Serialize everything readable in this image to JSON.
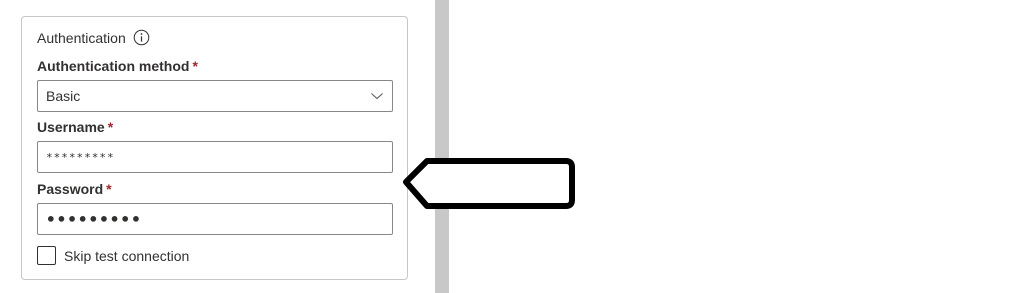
{
  "authentication": {
    "section_title": "Authentication",
    "info_icon": "info-icon",
    "method": {
      "label": "Authentication method",
      "required_marker": "*",
      "value": "Basic"
    },
    "username": {
      "label": "Username",
      "required_marker": "*",
      "value": "*********"
    },
    "password": {
      "label": "Password",
      "required_marker": "*",
      "value": "•••••••••"
    },
    "skip_test": {
      "label": "Skip test connection",
      "checked": false
    }
  },
  "colors": {
    "required": "#a4262c",
    "border": "#8a8886",
    "panel_border": "#c8c6c4",
    "splitter": "#c8c8c8",
    "annotation": "#000000"
  }
}
